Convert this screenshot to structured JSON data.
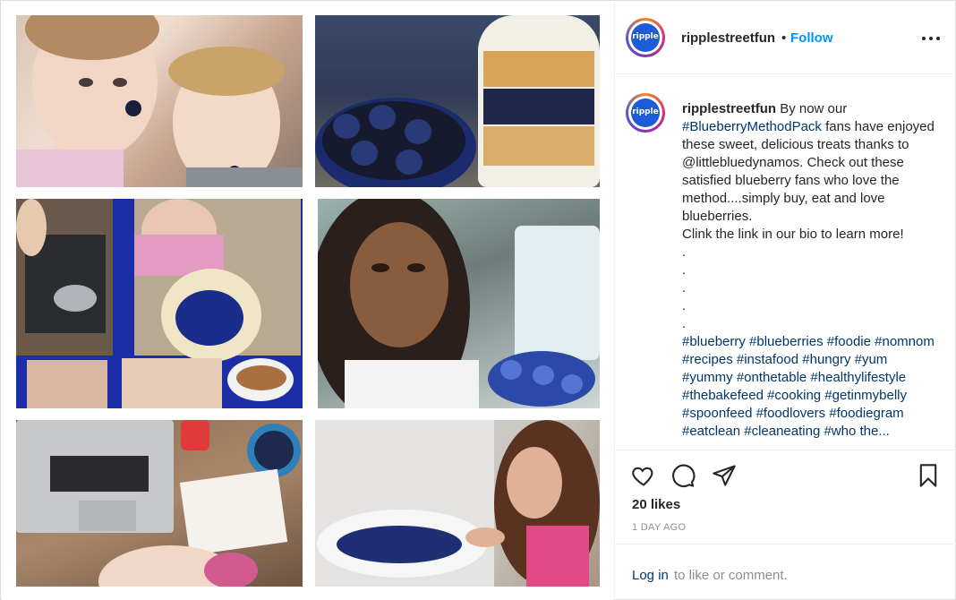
{
  "header": {
    "username": "ripplestreetfun",
    "separator": "•",
    "follow_label": "Follow",
    "avatar_text": "ripple"
  },
  "caption": {
    "username": "ripplestreetfun",
    "text_line1": "By now our",
    "hashtag_pack": "#BlueberryMethodPack",
    "text_part2": "fans have enjoyed these sweet, delicious treats thanks to @littlebluedynamos. Check out these satisfied blueberry fans who love the method....simply buy, eat and love blueberries.\nClink the link in our bio to learn more!\n.\n.\n.\n.\n.",
    "hashtags": "#blueberry #blueberries #foodie #nomnom #recipes #instafood #hungry #yum #yummy #onthetable #healthylifestyle #thebakefeed #cooking #getinmybelly #spoonfeed #foodlovers #foodiegram #eatclean #cleaneating #who the..."
  },
  "actions": {
    "icons": [
      "heart-icon",
      "comment-icon",
      "share-icon",
      "bookmark-icon"
    ],
    "likes": "20 likes",
    "timestamp": "1 DAY AGO",
    "login_link": "Log in",
    "login_text": "to like or comment."
  },
  "colors": {
    "link_blue": "#0095f6",
    "tag_blue": "#00376b",
    "muted": "#8e8e8e",
    "text": "#262626"
  }
}
